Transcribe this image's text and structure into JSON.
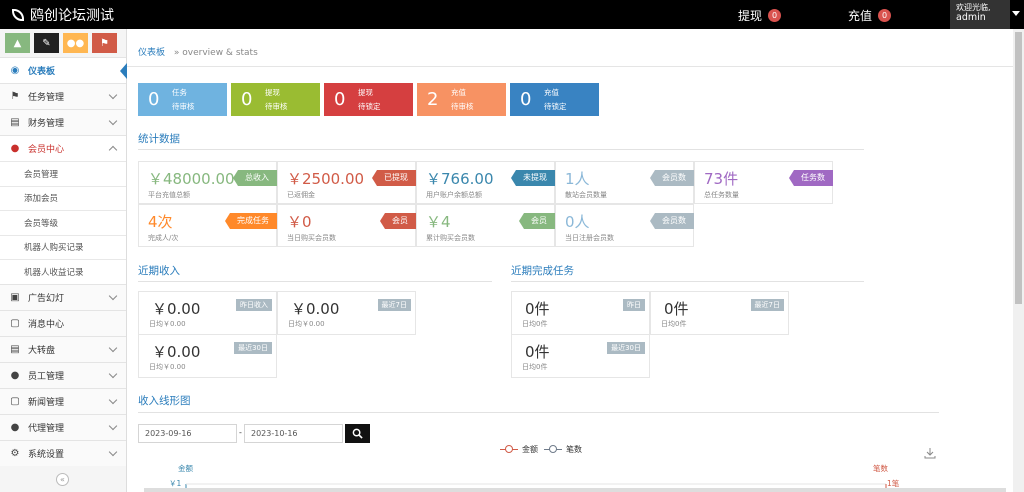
{
  "topbar": {
    "brand": "鸥创论坛测试",
    "withdraw_label": "提现",
    "withdraw_count": "0",
    "recharge_label": "充值",
    "recharge_count": "0",
    "welcome": "欢迎光临,",
    "username": "admin"
  },
  "sidebar": {
    "shortcuts": [
      {
        "icon": "signal-icon",
        "color": "#87b87f"
      },
      {
        "icon": "pencil-icon",
        "color": "#222222"
      },
      {
        "icon": "users-icon",
        "color": "#ffb752"
      },
      {
        "icon": "bell-icon",
        "color": "#d15b47"
      }
    ],
    "items": [
      {
        "label": "仪表板",
        "icon": "dashboard-icon"
      },
      {
        "label": "任务管理",
        "icon": "flag-icon"
      },
      {
        "label": "财务管理",
        "icon": "inbox-icon"
      },
      {
        "label": "会员中心",
        "icon": "user-icon"
      },
      {
        "label": "广告幻灯",
        "icon": "image-icon"
      },
      {
        "label": "消息中心",
        "icon": "bookmark-icon"
      },
      {
        "label": "大转盘",
        "icon": "inbox-icon"
      },
      {
        "label": "员工管理",
        "icon": "user-icon"
      },
      {
        "label": "新闻管理",
        "icon": "bookmark-icon"
      },
      {
        "label": "代理管理",
        "icon": "user-icon"
      },
      {
        "label": "系统设置",
        "icon": "gear-icon"
      }
    ],
    "subitems": [
      "会员管理",
      "添加会员",
      "会员等级",
      "机器人购买记录",
      "机器人收益记录"
    ],
    "collapse_symbol": "«"
  },
  "breadcrumb": {
    "home": "仪表板",
    "separator": "»",
    "sub": "overview & stats"
  },
  "infoboxes": [
    {
      "num": "0",
      "line1": "任务",
      "line2": "待审核",
      "color": "#6fb3e0"
    },
    {
      "num": "0",
      "line1": "提现",
      "line2": "待审核",
      "color": "#9abc32"
    },
    {
      "num": "0",
      "line1": "提现",
      "line2": "待锁定",
      "color": "#d53f40"
    },
    {
      "num": "2",
      "line1": "充值",
      "line2": "待审核",
      "color": "#f79263"
    },
    {
      "num": "0",
      "line1": "充值",
      "line2": "待锁定",
      "color": "#3983c2"
    }
  ],
  "stats_title": "统计数据",
  "stats": [
    {
      "value": "￥48000.00",
      "label": "平台充值总额",
      "tag": "总收入",
      "color": "#87b87f",
      "tagcolor": "#87b87f"
    },
    {
      "value": "￥2500.00",
      "label": "已返佣金",
      "tag": "已提现",
      "color": "#d15b47",
      "tagcolor": "#d15b47"
    },
    {
      "value": "￥766.00",
      "label": "用户账户余额总额",
      "tag": "未提现",
      "color": "#3a87ad",
      "tagcolor": "#3a87ad"
    },
    {
      "value": "1人",
      "label": "散站会员数量",
      "tag": "会员数",
      "color": "#8bb8d8",
      "tagcolor": "#abbac3"
    },
    {
      "value": "73件",
      "label": "总任务数量",
      "tag": "任务数",
      "color": "#a069c3",
      "tagcolor": "#a069c3"
    },
    {
      "value": "4次",
      "label": "完成人/次",
      "tag": "完成任务",
      "color": "#ff892a",
      "tagcolor": "#ff892a"
    },
    {
      "value": "￥0",
      "label": "当日购买会员数",
      "tag": "会员",
      "color": "#d15b47",
      "tagcolor": "#d15b47"
    },
    {
      "value": "￥4",
      "label": "累计购买会员数",
      "tag": "会员",
      "color": "#87b87f",
      "tagcolor": "#87b87f"
    },
    {
      "value": "0人",
      "label": "当日注册会员数",
      "tag": "会员数",
      "color": "#8bb8d8",
      "tagcolor": "#abbac3"
    }
  ],
  "income_title": "近期收入",
  "income": [
    {
      "value": "￥0.00",
      "sub": "日均￥0.00",
      "tag": "昨日收入"
    },
    {
      "value": "￥0.00",
      "sub": "日均￥0.00",
      "tag": "最近7日"
    },
    {
      "value": "￥0.00",
      "sub": "日均￥0.00",
      "tag": "最近30日"
    }
  ],
  "tasks_title": "近期完成任务",
  "tasks": [
    {
      "value": "0件",
      "sub": "日均0件",
      "tag": "昨日"
    },
    {
      "value": "0件",
      "sub": "日均0件",
      "tag": "最近7日"
    },
    {
      "value": "0件",
      "sub": "日均0件",
      "tag": "最近30日"
    }
  ],
  "chart_title": "收入线形图",
  "date_from": "2023-09-16",
  "date_sep": "-",
  "date_to": "2023-10-16",
  "chart_data": {
    "type": "line",
    "series": [
      {
        "name": "金额",
        "color": "#d15b47"
      },
      {
        "name": "笔数",
        "color": "#6f7b8a"
      }
    ],
    "left_axis_label": "金额",
    "right_axis_label": "笔数",
    "left_axis_top_tick": "￥1",
    "right_axis_top_tick": "1笔"
  }
}
